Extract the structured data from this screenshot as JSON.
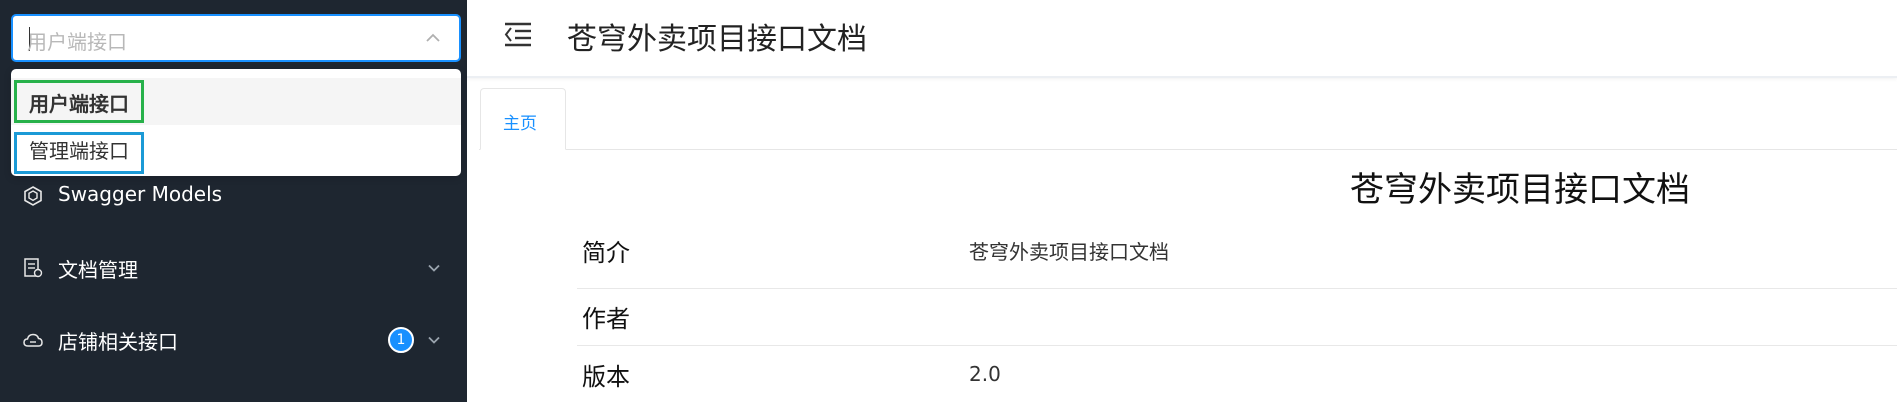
{
  "sidebar": {
    "select": {
      "placeholder": "用户端接口",
      "options": [
        {
          "label": "用户端接口"
        },
        {
          "label": "管理端接口"
        }
      ]
    },
    "menu": [
      {
        "label": "Swagger Models",
        "icon": "cube-icon"
      },
      {
        "label": "文档管理",
        "icon": "document-icon"
      },
      {
        "label": "店铺相关接口",
        "icon": "cloud-icon",
        "badge": "1"
      }
    ]
  },
  "header": {
    "title": "苍穹外卖项目接口文档"
  },
  "tabs": [
    {
      "label": "主页"
    }
  ],
  "main": {
    "title": "苍穹外卖项目接口文档",
    "info": [
      {
        "label": "简介",
        "value": "苍穹外卖项目接口文档"
      },
      {
        "label": "作者",
        "value": ""
      },
      {
        "label": "版本",
        "value": "2.0"
      }
    ]
  },
  "colors": {
    "sidebar_bg": "#1e2630",
    "accent": "#1890ff",
    "highlight_green": "#27b14a",
    "highlight_blue": "#1b9ad6"
  }
}
